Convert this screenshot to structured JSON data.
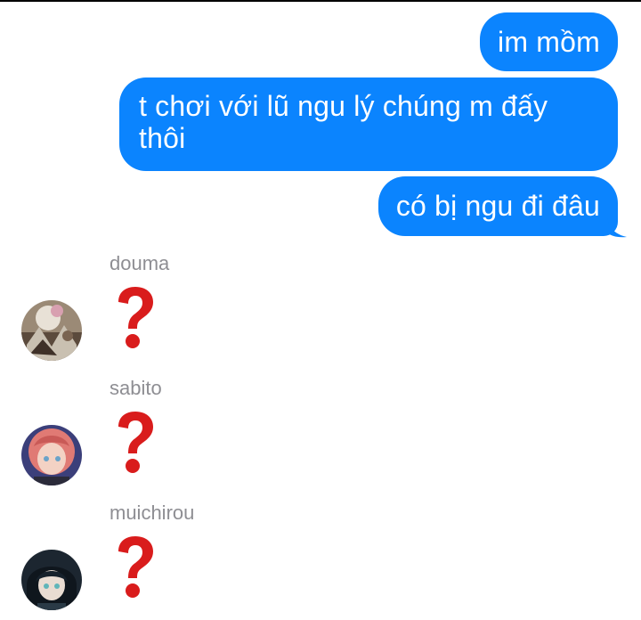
{
  "conversation": {
    "outgoing": [
      {
        "text": "im mồm"
      },
      {
        "text": "t chơi với lũ ngu lý chúng m đấy thôi"
      },
      {
        "text": "có bị ngu đi đâu"
      }
    ],
    "incoming": [
      {
        "sender": "douma",
        "reaction_icon": "question-mark-icon",
        "avatar_icon": "avatar-douma"
      },
      {
        "sender": "sabito",
        "reaction_icon": "question-mark-icon",
        "avatar_icon": "avatar-sabito"
      },
      {
        "sender": "muichirou",
        "reaction_icon": "question-mark-icon",
        "avatar_icon": "avatar-muichirou"
      }
    ]
  },
  "colors": {
    "bubble_blue": "#0b84fe",
    "question_red": "#d91c1c",
    "sender_gray": "#8e8e93"
  }
}
